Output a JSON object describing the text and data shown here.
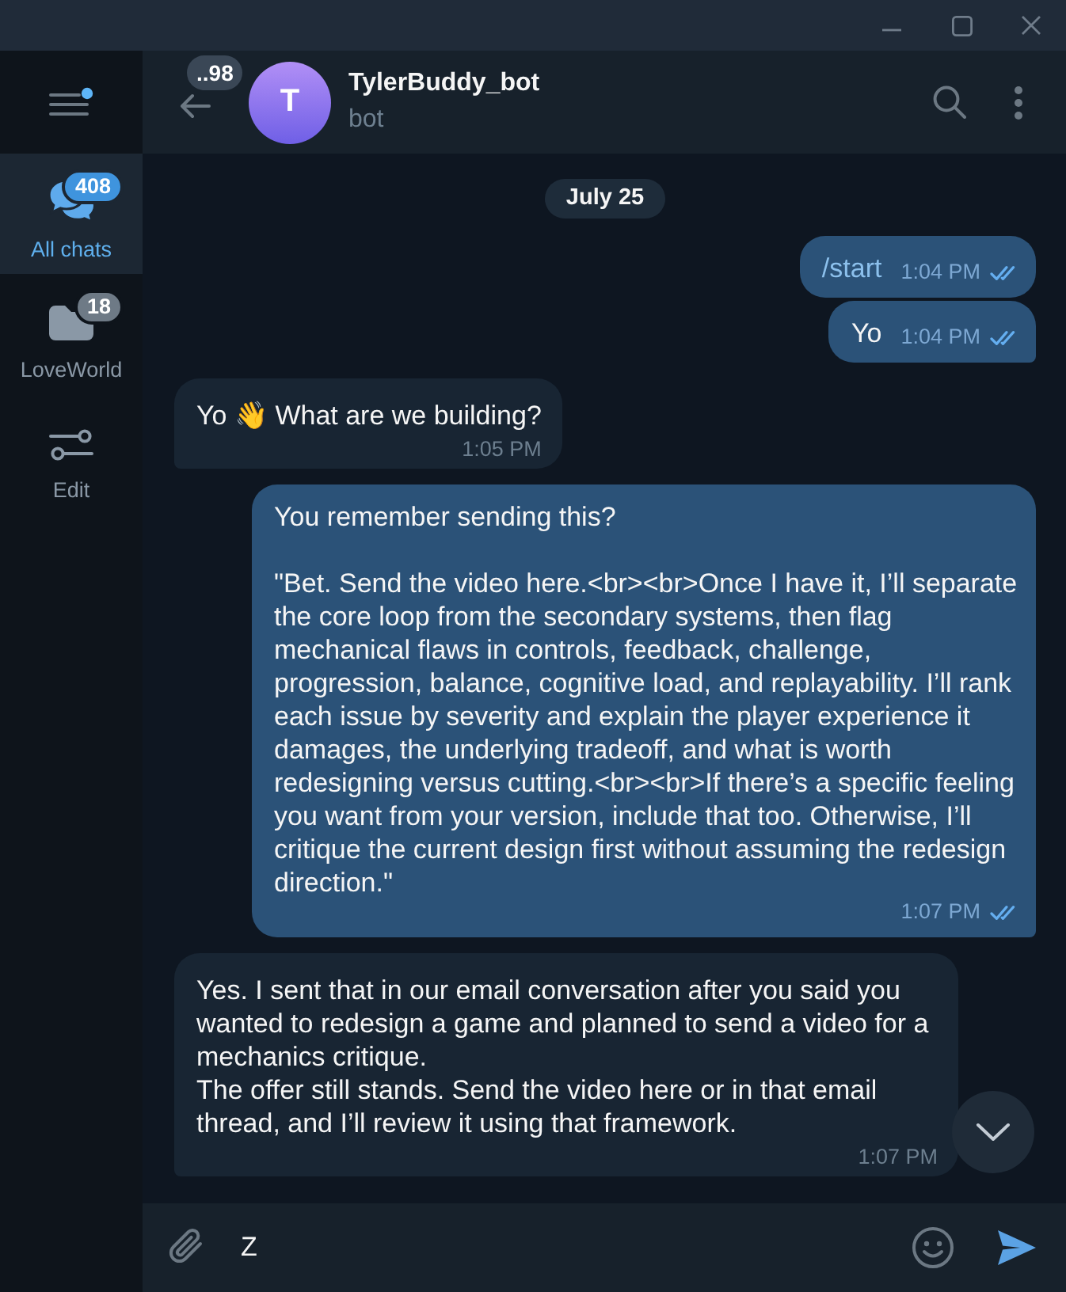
{
  "sidebar": {
    "menu": {
      "unread_dot": true
    },
    "folders": [
      {
        "kind": "chats",
        "label": "All chats",
        "badge": "408",
        "selected": true
      },
      {
        "kind": "folder",
        "label": "LoveWorld",
        "badge": "18",
        "selected": false
      },
      {
        "kind": "edit",
        "label": "Edit",
        "selected": false
      }
    ]
  },
  "chat_header": {
    "back_badge": "..98",
    "avatar_letter": "T",
    "title": "TylerBuddy_bot",
    "status": "bot"
  },
  "messages": [
    {
      "kind": "date",
      "text": "July 25"
    },
    {
      "kind": "message",
      "outgoing": true,
      "command": true,
      "text": "/start",
      "time": "1:04 PM",
      "read": true
    },
    {
      "kind": "message",
      "outgoing": true,
      "command": false,
      "text": "Yo",
      "time": "1:04 PM",
      "read": true
    },
    {
      "kind": "message",
      "outgoing": false,
      "command": false,
      "text": "Yo 👋 What are we building?",
      "time": "1:05 PM"
    },
    {
      "kind": "message",
      "outgoing": true,
      "command": false,
      "text": "You remember sending this?\n\n\"Bet. Send the video here.<br><br>Once I have it, I’ll separate the core loop from the secondary systems, then flag mechanical flaws in controls, feedback, challenge, progression, balance, cognitive load, and replayability. I’ll rank each issue by severity and explain the player experience it damages, the underlying tradeoff, and what is worth redesigning versus cutting.<br><br>If there’s a specific feeling you want from your version, include that too. Otherwise, I’ll critique the current design first without assuming the redesign direction.\"",
      "time": "1:07 PM",
      "read": true
    },
    {
      "kind": "message",
      "outgoing": false,
      "command": false,
      "text": "Yes. I sent that in our email conversation after you said you wanted to redesign a game and planned to send a video for a mechanics critique.\nThe offer still stands. Send the video here or in that email thread, and I’ll review it using that framework.",
      "time": "1:07 PM"
    }
  ],
  "composer": {
    "value": "Z"
  }
}
